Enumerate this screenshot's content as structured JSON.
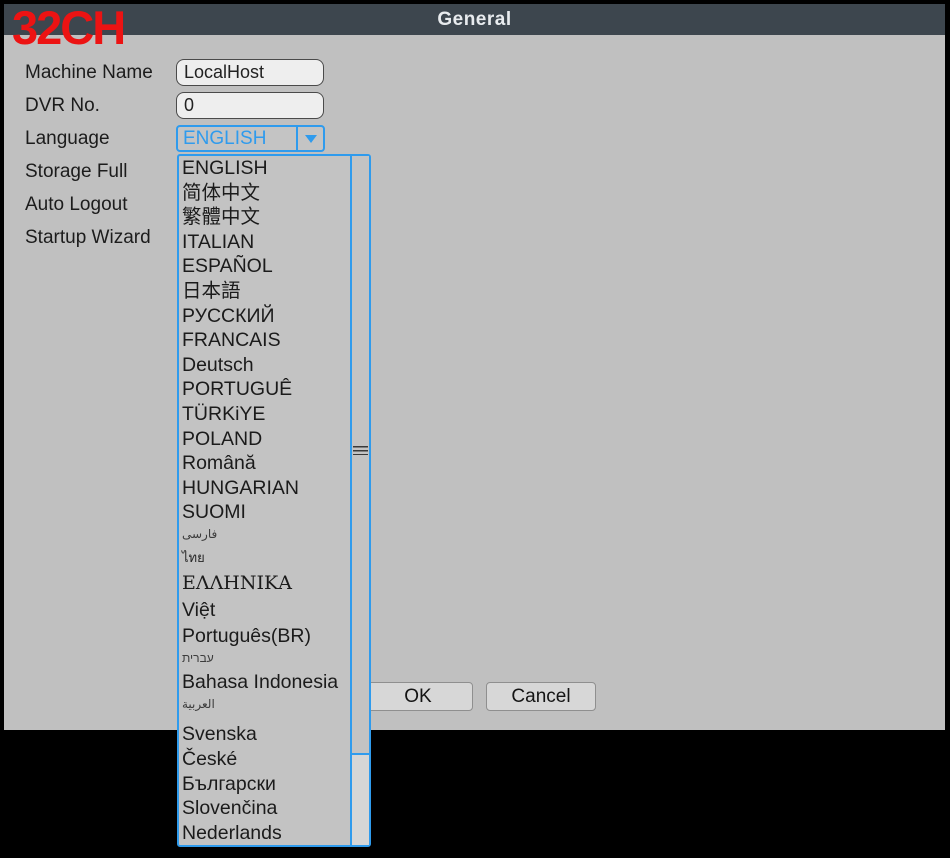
{
  "overlay": {
    "badge": "32CH"
  },
  "titlebar": {
    "title": "General"
  },
  "form": {
    "machine_name": {
      "label": "Machine Name",
      "value": "LocalHost"
    },
    "dvr_no": {
      "label": "DVR No.",
      "value": "0"
    },
    "language": {
      "label": "Language",
      "value": "ENGLISH"
    },
    "storage_full": {
      "label": "Storage Full"
    },
    "auto_logout": {
      "label": "Auto Logout"
    },
    "startup_wizard": {
      "label": "Startup Wizard"
    }
  },
  "dropdown": {
    "selected": "ENGLISH",
    "arrow_icon": "dropdown-arrow",
    "items": [
      {
        "text": "ENGLISH",
        "variant": ""
      },
      {
        "text": "简体中文",
        "variant": ""
      },
      {
        "text": "繁體中文",
        "variant": ""
      },
      {
        "text": "ITALIAN",
        "variant": ""
      },
      {
        "text": "ESPAÑOL",
        "variant": ""
      },
      {
        "text": "日本語",
        "variant": ""
      },
      {
        "text": "РУССКИЙ",
        "variant": ""
      },
      {
        "text": "FRANCAIS",
        "variant": ""
      },
      {
        "text": "Deutsch",
        "variant": ""
      },
      {
        "text": "PORTUGUÊ",
        "variant": ""
      },
      {
        "text": "TÜRKiYE",
        "variant": ""
      },
      {
        "text": "POLAND",
        "variant": ""
      },
      {
        "text": "Română",
        "variant": ""
      },
      {
        "text": "HUNGARIAN",
        "variant": ""
      },
      {
        "text": "SUOMI",
        "variant": ""
      },
      {
        "text": "فارسی",
        "variant": "small"
      },
      {
        "text": "ไทย",
        "variant": "thai"
      },
      {
        "text": "ΕΛΛΗΝΙΚΑ",
        "variant": "serif"
      },
      {
        "text": "Việt",
        "variant": "tall"
      },
      {
        "text": "Português(BR)",
        "variant": "tall"
      },
      {
        "text": "עברית",
        "variant": "small"
      },
      {
        "text": "Bahasa Indonesia",
        "variant": "tall"
      },
      {
        "text": "العربية",
        "variant": "small"
      },
      {
        "text": "Svenska",
        "variant": "tall gap"
      },
      {
        "text": "České",
        "variant": ""
      },
      {
        "text": "Български",
        "variant": ""
      },
      {
        "text": "Slovenčina",
        "variant": ""
      },
      {
        "text": "Nederlands",
        "variant": ""
      }
    ]
  },
  "buttons": {
    "ok": "OK",
    "cancel": "Cancel"
  },
  "colors": {
    "accent_blue": "#2f9bed",
    "badge_red": "#ec1313",
    "titlebar_bg": "#3d464e",
    "panel_bg": "#c0c0c0",
    "outer_bg": "#000000"
  }
}
